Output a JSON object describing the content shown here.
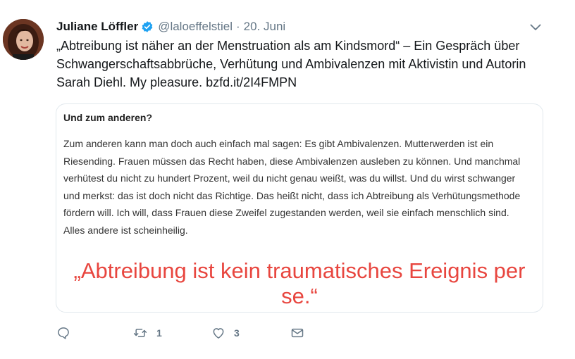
{
  "tweet": {
    "author_name": "Juliane Löffler",
    "handle": "@laloeffelstiel",
    "separator": "·",
    "date": "20. Juni",
    "text": "„Abtreibung ist näher an der Menstruation als am Kindsmord“ – Ein Gespräch über Schwangerschaftsabbrüche, Verhütung und Ambivalenzen mit Aktivistin und Autorin Sarah Diehl. My pleasure. bzfd.it/2I4FMPN",
    "verified_icon": "verified-badge-icon",
    "menu_icon": "chevron-down-icon"
  },
  "card": {
    "heading": "Und zum anderen?",
    "body": "Zum anderen kann man doch auch einfach mal sagen: Es gibt Ambivalenzen. Mutterwerden ist ein Riesending. Frauen müssen das Recht haben, diese Ambivalenzen ausleben zu können. Und manchmal verhütest du nicht zu hundert Prozent, weil du nicht genau weißt, was du willst. Und du wirst schwanger und merkst: das ist doch nicht das Richtige. Das heißt nicht, dass ich Abtreibung als Verhütungsmethode fördern will. Ich will, dass Frauen diese Zweifel zugestanden werden, weil sie einfach menschlich sind. Alles andere ist scheinheilig.",
    "quote": "„Abtreibung ist kein traumatisches Ereignis per se.“"
  },
  "actions": {
    "reply": {
      "icon": "reply-icon",
      "count": ""
    },
    "retweet": {
      "icon": "retweet-icon",
      "count": "1"
    },
    "like": {
      "icon": "heart-icon",
      "count": "3"
    },
    "dm": {
      "icon": "envelope-icon",
      "count": ""
    }
  },
  "colors": {
    "verified": "#1da1f2",
    "muted": "#657786",
    "quote_red": "#e8463f",
    "card_border": "#e1e8ed"
  }
}
